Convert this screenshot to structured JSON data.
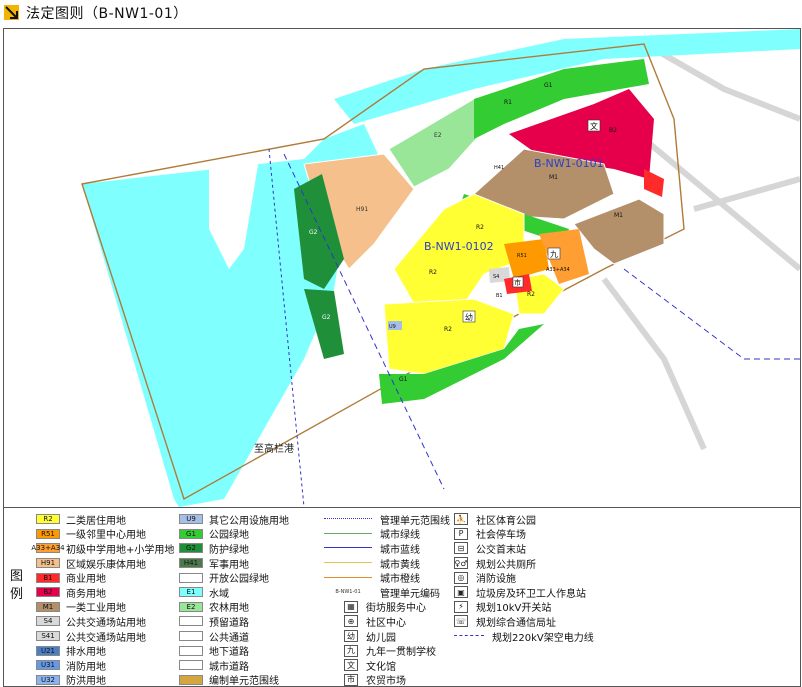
{
  "header": {
    "title": "法定图则（B-NW1-01）"
  },
  "map": {
    "unit_labels": {
      "unit_0101": "B-NW1-0101",
      "unit_0102": "B-NW1-0102"
    },
    "water_name": "至高栏港",
    "parcels": {
      "h91": "H91",
      "e2_north": "E2",
      "r1_top": "R1",
      "g1_top": "G1",
      "b2_top": "B2",
      "h41": "H41",
      "m1_a": "M1",
      "m1_b": "M1",
      "r2_a": "R2",
      "r2_b": "R2",
      "r2_c": "R2",
      "r2_d": "R2",
      "g2_west": "G2",
      "g2_sw": "G2",
      "u9": "U9",
      "r51": "R51",
      "s4": "S4",
      "a33": "A33+A34",
      "b1": "B1",
      "g1_a": "G1",
      "g1_b": "G1"
    },
    "icon_glyphs": {
      "school": "九",
      "kindergarten": "幼",
      "culture": "文",
      "market": "市"
    }
  },
  "legend": {
    "heading": "图 例",
    "landuse": [
      {
        "code": "R2",
        "label": "二类居住用地",
        "color": "#ffff33"
      },
      {
        "code": "R51",
        "label": "一级邻里中心用地",
        "color": "#ff9900"
      },
      {
        "code": "A33+A34",
        "label": "初级中学用地+小学用地",
        "color": "#ff9f33"
      },
      {
        "code": "H91",
        "label": "区域娱乐康体用地",
        "color": "#f5c08c"
      },
      {
        "code": "B1",
        "label": "商业用地",
        "color": "#ff2a2a"
      },
      {
        "code": "B2",
        "label": "商务用地",
        "color": "#e6004c"
      },
      {
        "code": "M1",
        "label": "一类工业用地",
        "color": "#b38f6a"
      },
      {
        "code": "S4",
        "label": "公共交通场站用地",
        "color": "#d9d9d9"
      },
      {
        "code": "S41",
        "label": "公共交通场站用地",
        "color": "#d9d9d9"
      },
      {
        "code": "U21",
        "label": "排水用地",
        "color": "#4d7fc4"
      },
      {
        "code": "U31",
        "label": "消防用地",
        "color": "#6699e6"
      },
      {
        "code": "U32",
        "label": "防洪用地",
        "color": "#8cb3f0"
      }
    ],
    "landuse2": [
      {
        "code": "U9",
        "label": "其它公用设施用地",
        "color": "#a6bfe6"
      },
      {
        "code": "G1",
        "label": "公园绿地",
        "color": "#33cc33"
      },
      {
        "code": "G2",
        "label": "防护绿地",
        "color": "#1f8f3a"
      },
      {
        "code": "H41",
        "label": "军事用地",
        "color": "#4d7a4d"
      },
      {
        "code": "",
        "label": "开放公园绿地",
        "color": "#ffffff"
      },
      {
        "code": "E1",
        "label": "水域",
        "color": "#80ffff"
      },
      {
        "code": "E2",
        "label": "农林用地",
        "color": "#99e699"
      },
      {
        "code": "",
        "label": "预留道路",
        "color": "#ffffff"
      },
      {
        "code": "",
        "label": "公共通道",
        "color": "#ffffff"
      },
      {
        "code": "",
        "label": "地下道路",
        "color": "#ffffff"
      },
      {
        "code": "",
        "label": "城市道路",
        "color": "#ffffff"
      },
      {
        "code": "",
        "label": "编制单元范围线",
        "color": "#d4a640"
      }
    ],
    "lines": [
      {
        "label": "管理单元范围线",
        "color": "#3333cc",
        "style": "dotted"
      },
      {
        "label": "城市绿线",
        "color": "#66aa66",
        "style": "solid"
      },
      {
        "label": "城市蓝线",
        "color": "#3333cc",
        "style": "solid"
      },
      {
        "label": "城市黄线",
        "color": "#e6c34d",
        "style": "solid"
      },
      {
        "label": "城市橙线",
        "color": "#e68a2e",
        "style": "solid"
      }
    ],
    "unit_code_sample": "B-NW1-01",
    "unit_code_label": "管理单元编码",
    "facilities": [
      {
        "glyph": "▦",
        "label": "街坊服务中心"
      },
      {
        "glyph": "⊕",
        "label": "社区中心"
      },
      {
        "glyph": "幼",
        "label": "幼儿园"
      },
      {
        "glyph": "九",
        "label": "九年一贯制学校"
      },
      {
        "glyph": "文",
        "label": "文化馆"
      },
      {
        "glyph": "市",
        "label": "农贸市场"
      }
    ],
    "facilities2": [
      {
        "glyph": "⛹",
        "label": "社区体育公园"
      },
      {
        "glyph": "P",
        "label": "社会停车场"
      },
      {
        "glyph": "⊟",
        "label": "公交首末站"
      },
      {
        "glyph": "♀♂",
        "label": "规划公共厕所"
      },
      {
        "glyph": "◎",
        "label": "消防设施"
      },
      {
        "glyph": "▣",
        "label": "垃圾房及环卫工人作息站"
      },
      {
        "glyph": "⚡",
        "label": "规划10kV开关站"
      },
      {
        "glyph": "☏",
        "label": "规划综合通信局址"
      }
    ],
    "powerline_label": "规划220kV架空电力线"
  }
}
